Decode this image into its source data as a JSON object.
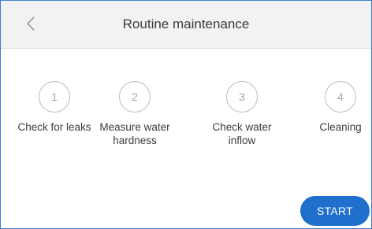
{
  "header": {
    "title": "Routine maintenance",
    "back_icon": "chevron-left-icon"
  },
  "steps": [
    {
      "number": "1",
      "label": "Check for leaks"
    },
    {
      "number": "2",
      "label": "Measure water hardness"
    },
    {
      "number": "3",
      "label": "Check water inflow"
    },
    {
      "number": "4",
      "label": "Cleaning"
    }
  ],
  "actions": {
    "start_label": "START"
  },
  "colors": {
    "accent": "#1f6fcc",
    "header_bg": "#f2f2f2",
    "step_circle_border": "#bdbdbd"
  }
}
